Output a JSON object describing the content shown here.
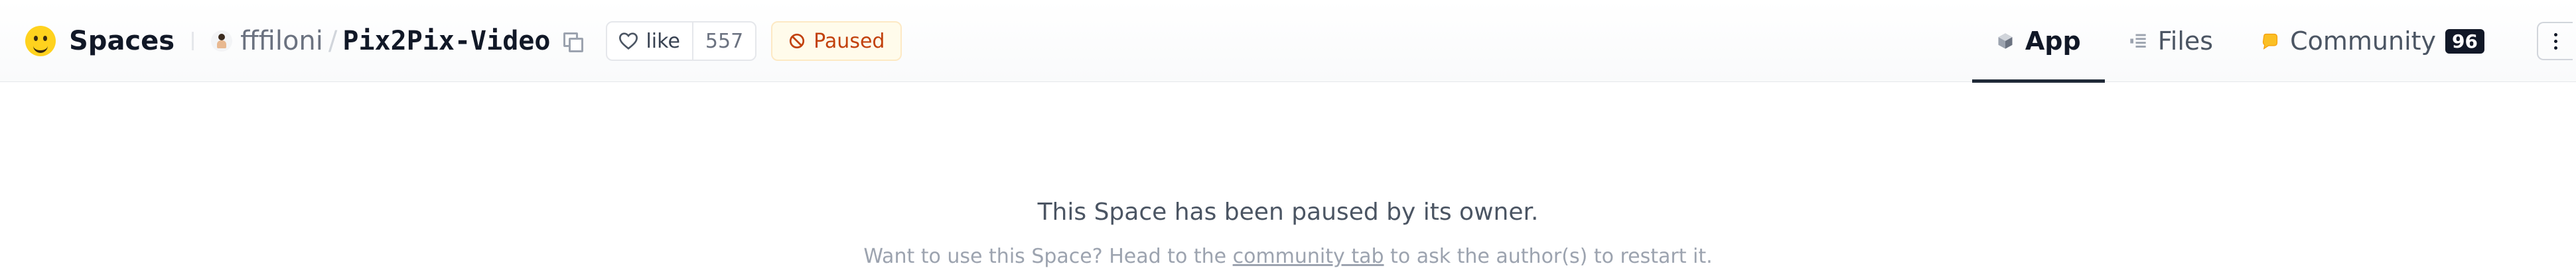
{
  "header": {
    "brand_label": "Spaces",
    "owner": "fffiloni",
    "separator": "/",
    "repo_name": "Pix2Pix-Video",
    "like_label": "like",
    "like_count": "557",
    "status_label": "Paused",
    "status_color": "#c2410c"
  },
  "tabs": [
    {
      "label": "App",
      "icon": "cube-icon",
      "active": true
    },
    {
      "label": "Files",
      "icon": "files-icon",
      "active": false
    },
    {
      "label": "Community",
      "icon": "community-icon",
      "active": false,
      "badge": "96"
    }
  ],
  "main": {
    "title": "This Space has been paused by its owner.",
    "subtitle_prefix": "Want to use this Space? Head to the ",
    "subtitle_link": "community tab",
    "subtitle_suffix": " to ask the author(s) to restart it."
  }
}
